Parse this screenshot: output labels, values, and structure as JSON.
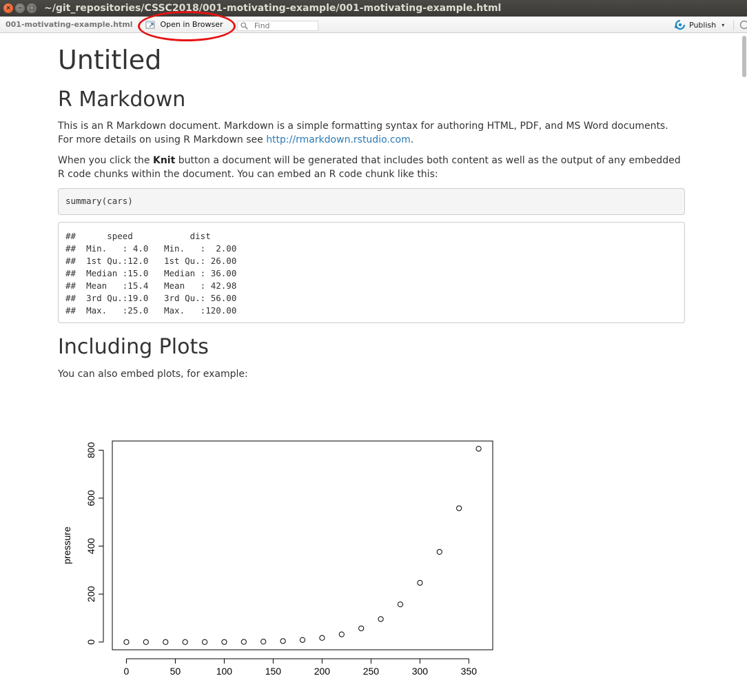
{
  "window": {
    "title": "~/git_repositories/CSSC2018/001-motivating-example/001-motivating-example.html",
    "close_glyph": "×",
    "min_glyph": "–",
    "max_glyph": "□"
  },
  "toolbar": {
    "file_name": "001-motivating-example.html",
    "open_in_browser_label": "Open in Browser",
    "find_placeholder": "Find",
    "publish_label": "Publish",
    "publish_caret": "▾",
    "highlight_color": "#e61414"
  },
  "document": {
    "title": "Untitled",
    "section1_heading": "R Markdown",
    "para1_text": "This is an R Markdown document. Markdown is a simple formatting syntax for authoring HTML, PDF, and MS Word documents. For more details on using R Markdown see ",
    "para1_link": "http://rmarkdown.rstudio.com",
    "para1_end": ".",
    "para2_start": "When you click the ",
    "para2_bold": "Knit",
    "para2_end": " button a document will be generated that includes both content as well as the output of any embedded R code chunks within the document. You can embed an R code chunk like this:",
    "code_source": "summary(cars)",
    "code_output": [
      "##      speed           dist       ",
      "##  Min.   : 4.0   Min.   :  2.00  ",
      "##  1st Qu.:12.0   1st Qu.: 26.00  ",
      "##  Median :15.0   Median : 36.00  ",
      "##  Mean   :15.4   Mean   : 42.98  ",
      "##  3rd Qu.:19.0   3rd Qu.: 56.00  ",
      "##  Max.   :25.0   Max.   :120.00  "
    ],
    "section2_heading": "Including Plots",
    "para3_text": "You can also embed plots, for example:",
    "link_color": "#2a7ab7"
  },
  "chart_data": {
    "type": "scatter",
    "title": "",
    "xlabel": "",
    "ylabel": "pressure",
    "x": [
      0,
      20,
      40,
      60,
      80,
      100,
      120,
      140,
      160,
      180,
      200,
      220,
      240,
      260,
      280,
      300,
      320,
      340,
      360
    ],
    "y": [
      0.0002,
      0.0012,
      0.006,
      0.03,
      0.09,
      0.27,
      0.75,
      1.85,
      4.2,
      8.8,
      17.3,
      32.1,
      57.0,
      96.0,
      157.0,
      247.0,
      376.0,
      558.0,
      806.0
    ],
    "xlim": [
      -14.4,
      374.4
    ],
    "ylim": [
      -32.24,
      838.24
    ],
    "x_ticks": [
      "0",
      "50",
      "100",
      "150",
      "200",
      "250",
      "300",
      "350"
    ],
    "y_ticks": [
      "0",
      "200",
      "400",
      "600",
      "800"
    ],
    "grid": false,
    "marker": "open-circle"
  }
}
